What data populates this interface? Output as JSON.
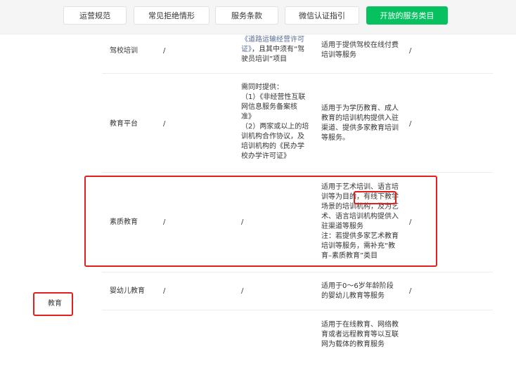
{
  "tabs": [
    {
      "label": "运营规范",
      "active": false
    },
    {
      "label": "常见拒绝情形",
      "active": false
    },
    {
      "label": "服务条款",
      "active": false
    },
    {
      "label": "微信认证指引",
      "active": false
    },
    {
      "label": "开放的服务类目",
      "active": true
    }
  ],
  "category": "教育",
  "rows": [
    {
      "name": "驾校培训",
      "col2": "/",
      "req": [
        {
          "text": "《道路运输经营许可",
          "link": true
        },
        {
          "text": "证》",
          "link": true,
          "suffix": "，且其中须有“驾"
        },
        {
          "text": "驶员培训”项目",
          "link": false
        }
      ],
      "desc": [
        "适用于提供驾校在线付费",
        "培训等服务"
      ],
      "col5": "/"
    },
    {
      "name": "教育平台",
      "col2": "/",
      "req": [
        {
          "text": "需同时提供："
        },
        {
          "text": "（1）《非经营性互联"
        },
        {
          "text": "网信息服务备案核"
        },
        {
          "text": "准》"
        },
        {
          "text": "（2）两家或以上的培"
        },
        {
          "text": "训机构合作协议，及"
        },
        {
          "text": "培训机构的《民办学"
        },
        {
          "text": "校办学许可证》"
        }
      ],
      "desc": [
        "适用于为学历教育、成人",
        "教育的培训机构提供入驻",
        "渠道、提供多家教育培训",
        "等服务。"
      ],
      "col5": "/"
    },
    {
      "name": "素质教育",
      "col2": "/",
      "req_text": "/",
      "desc": [
        "适用于艺术培训、语言培",
        "训等为目的，有线下教学",
        "场景的培训机构，及为艺",
        "术、语言培训机构提供入",
        "驻渠道等服务",
        "注：若提供多家艺术教育",
        "培训等服务，需补充“教",
        "育–素质教育”类目"
      ],
      "col5": "/"
    },
    {
      "name": "婴幼儿教育",
      "col2": "/",
      "req_text": "/",
      "desc": [
        "适用于0～6岁年龄阶段",
        "的婴幼儿教育等服务"
      ],
      "col5": "/"
    },
    {
      "name": "",
      "desc": [
        "适用于在线教育、网络教",
        "育或者远程教育等以互联",
        "网为载体的教育服务"
      ]
    }
  ]
}
